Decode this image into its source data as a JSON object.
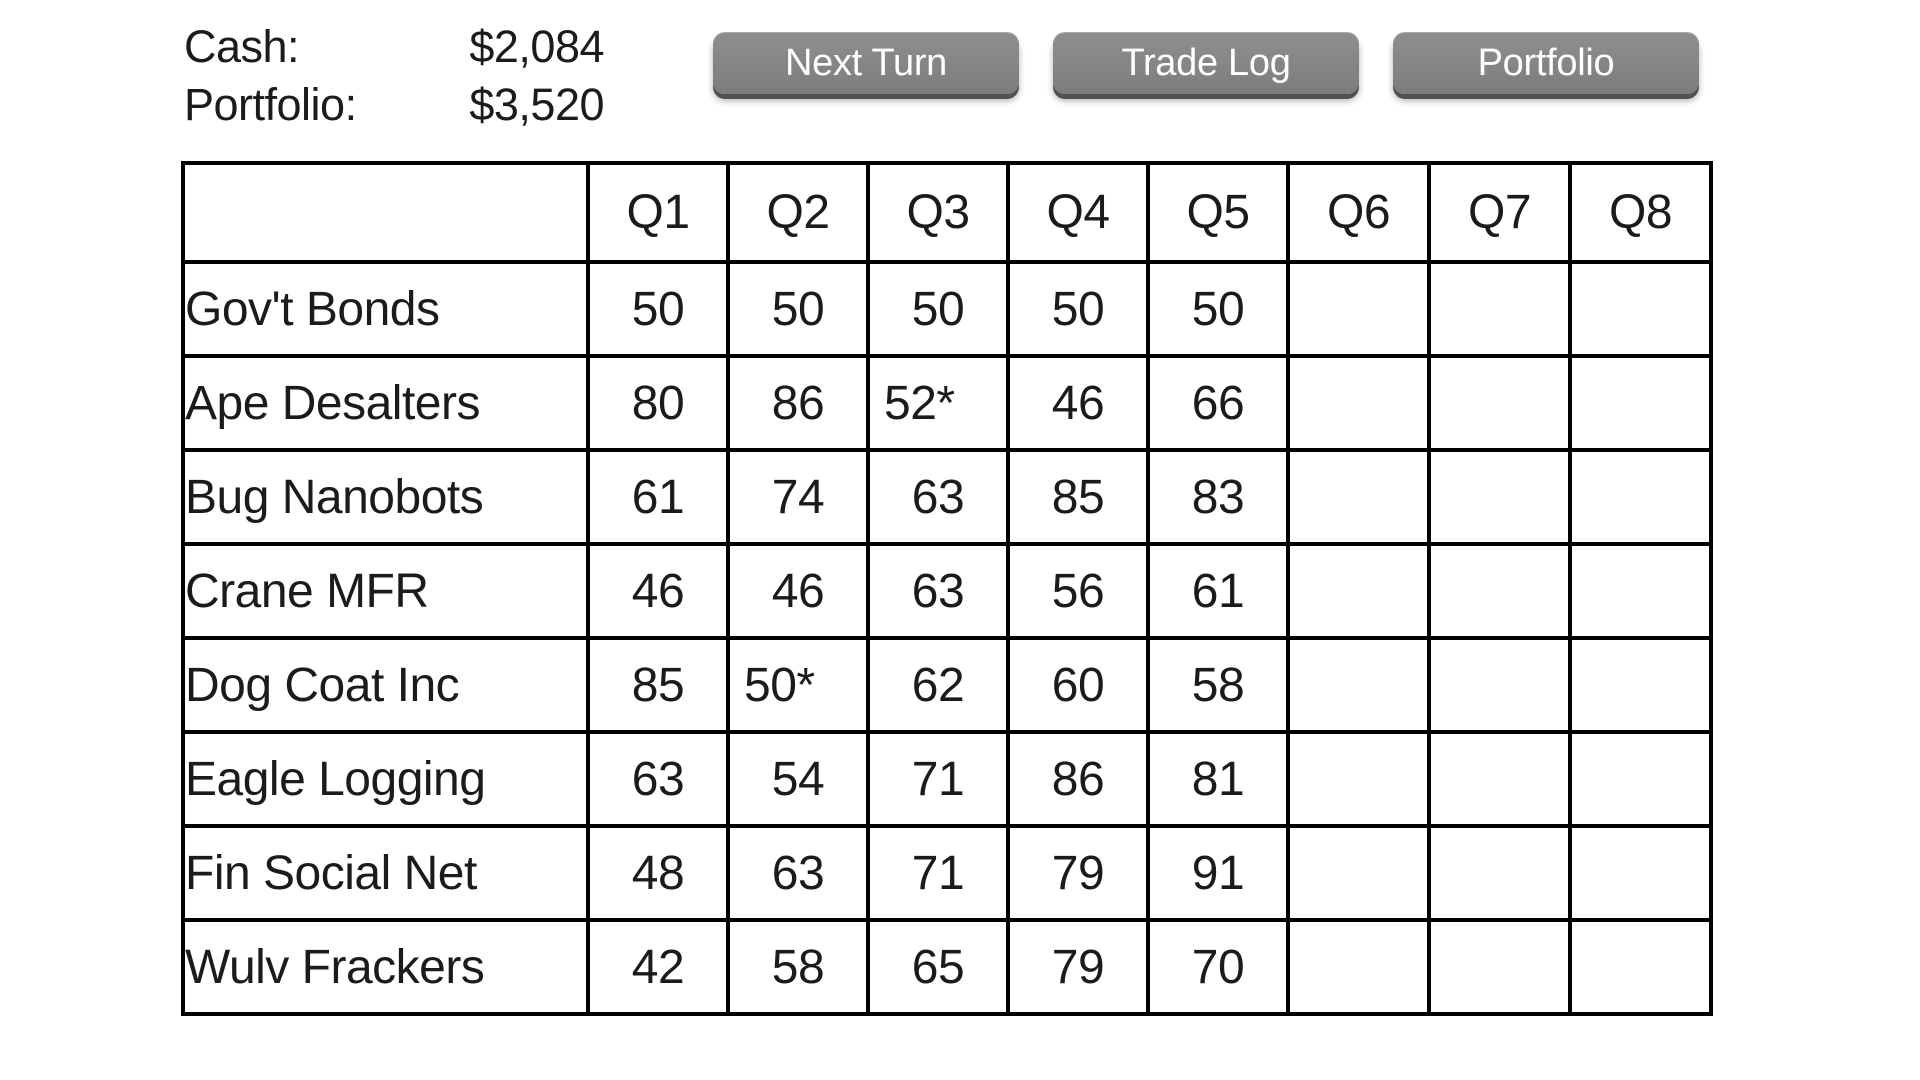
{
  "status": {
    "cash_label": "Cash:",
    "cash_value": "$2,084",
    "portfolio_label": "Portfolio:",
    "portfolio_value": "$3,520"
  },
  "buttons": {
    "next_turn": "Next Turn",
    "trade_log": "Trade Log",
    "portfolio": "Portfolio"
  },
  "colors": {
    "up": "#2d7a2d",
    "down": "#e02b2b",
    "flat": "#1b1b1b",
    "button_face": "#878787",
    "button_shadow": "#515151",
    "border": "#000000"
  },
  "table": {
    "corner_label": "",
    "columns": [
      "Q1",
      "Q2",
      "Q3",
      "Q4",
      "Q5",
      "Q6",
      "Q7",
      "Q8"
    ],
    "rows": [
      {
        "name": "Gov't Bonds",
        "cells": [
          {
            "text": "50",
            "trend": "flat"
          },
          {
            "text": "50",
            "trend": "flat"
          },
          {
            "text": "50",
            "trend": "flat"
          },
          {
            "text": "50",
            "trend": "flat"
          },
          {
            "text": "50",
            "trend": "flat"
          },
          {
            "text": "",
            "trend": "empty"
          },
          {
            "text": "",
            "trend": "empty"
          },
          {
            "text": "",
            "trend": "empty"
          }
        ]
      },
      {
        "name": "Ape Desalters",
        "cells": [
          {
            "text": "80",
            "trend": "flat"
          },
          {
            "text": "86",
            "trend": "up"
          },
          {
            "text": "52*",
            "trend": "flat"
          },
          {
            "text": "46",
            "trend": "down"
          },
          {
            "text": "66",
            "trend": "up"
          },
          {
            "text": "",
            "trend": "empty"
          },
          {
            "text": "",
            "trend": "empty"
          },
          {
            "text": "",
            "trend": "empty"
          }
        ]
      },
      {
        "name": "Bug Nanobots",
        "cells": [
          {
            "text": "61",
            "trend": "flat"
          },
          {
            "text": "74",
            "trend": "up"
          },
          {
            "text": "63",
            "trend": "down"
          },
          {
            "text": "85",
            "trend": "up"
          },
          {
            "text": "83",
            "trend": "down"
          },
          {
            "text": "",
            "trend": "empty"
          },
          {
            "text": "",
            "trend": "empty"
          },
          {
            "text": "",
            "trend": "empty"
          }
        ]
      },
      {
        "name": "Crane MFR",
        "cells": [
          {
            "text": "46",
            "trend": "flat"
          },
          {
            "text": "46",
            "trend": "flat"
          },
          {
            "text": "63",
            "trend": "up"
          },
          {
            "text": "56",
            "trend": "down"
          },
          {
            "text": "61",
            "trend": "up"
          },
          {
            "text": "",
            "trend": "empty"
          },
          {
            "text": "",
            "trend": "empty"
          },
          {
            "text": "",
            "trend": "empty"
          }
        ]
      },
      {
        "name": "Dog Coat Inc",
        "cells": [
          {
            "text": "85",
            "trend": "flat"
          },
          {
            "text": "50*",
            "trend": "flat"
          },
          {
            "text": "62",
            "trend": "up"
          },
          {
            "text": "60",
            "trend": "down"
          },
          {
            "text": "58",
            "trend": "down"
          },
          {
            "text": "",
            "trend": "empty"
          },
          {
            "text": "",
            "trend": "empty"
          },
          {
            "text": "",
            "trend": "empty"
          }
        ]
      },
      {
        "name": "Eagle Logging",
        "cells": [
          {
            "text": "63",
            "trend": "flat"
          },
          {
            "text": "54",
            "trend": "down"
          },
          {
            "text": "71",
            "trend": "up"
          },
          {
            "text": "86",
            "trend": "up"
          },
          {
            "text": "81",
            "trend": "down"
          },
          {
            "text": "",
            "trend": "empty"
          },
          {
            "text": "",
            "trend": "empty"
          },
          {
            "text": "",
            "trend": "empty"
          }
        ]
      },
      {
        "name": "Fin Social Net",
        "cells": [
          {
            "text": "48",
            "trend": "flat"
          },
          {
            "text": "63",
            "trend": "up"
          },
          {
            "text": "71",
            "trend": "up"
          },
          {
            "text": "79",
            "trend": "up"
          },
          {
            "text": "91",
            "trend": "up"
          },
          {
            "text": "",
            "trend": "empty"
          },
          {
            "text": "",
            "trend": "empty"
          },
          {
            "text": "",
            "trend": "empty"
          }
        ]
      },
      {
        "name": "Wulv Frackers",
        "cells": [
          {
            "text": "42",
            "trend": "flat"
          },
          {
            "text": "58",
            "trend": "up"
          },
          {
            "text": "65",
            "trend": "up"
          },
          {
            "text": "79",
            "trend": "up"
          },
          {
            "text": "70",
            "trend": "down"
          },
          {
            "text": "",
            "trend": "empty"
          },
          {
            "text": "",
            "trend": "empty"
          },
          {
            "text": "",
            "trend": "empty"
          }
        ]
      }
    ]
  }
}
